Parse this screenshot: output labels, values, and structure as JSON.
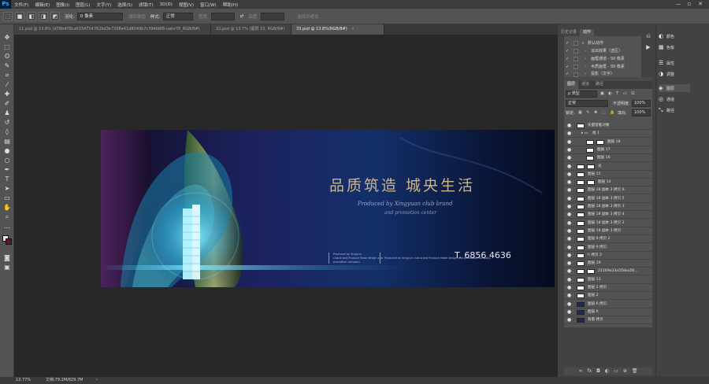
{
  "app": {
    "logo": "Ps"
  },
  "menu": [
    "文件(F)",
    "编辑(E)",
    "图像(I)",
    "图层(L)",
    "文字(Y)",
    "选择(S)",
    "滤镜(T)",
    "3D(D)",
    "视图(V)",
    "窗口(W)",
    "帮助(H)"
  ],
  "window_controls": {
    "minimize": "—",
    "restore": "▫",
    "close": "✕"
  },
  "options_bar": {
    "feather_label": "羽化:",
    "feather_value": "0 像素",
    "antialias_label": "消除锯齿",
    "style_label": "样式:",
    "style_value": "正常",
    "width_label": "宽度:",
    "height_label": "高度:",
    "select_mask_label": "选择并遮住..."
  },
  "document_tabs": [
    {
      "label": "11.psd @ 13.8% (d78b478ca6334754762bd3e7308e41d8040b7c394b6f8-uakv7E_RGB/8#)",
      "active": false
    },
    {
      "label": "22.psd @ 13.7% (图层 13, RGB/8#)",
      "active": false
    },
    {
      "label": "33.psd @ 13.8%(RGB/8#)",
      "active": true
    }
  ],
  "tab_close": "×",
  "banner": {
    "headline": "品质筑造  城央生活",
    "script_line1": "Produced by Xingyuan club brand",
    "script_line2": "and promotion center",
    "small_text_1": "Produced by Xingyun\nclub brand Produce Made design and\npromotion company",
    "small_text_2": "Produced by Xingyun club brand Produce Made design and promotion company",
    "phone": "T. 6856 4636"
  },
  "status_bar": {
    "zoom": "13.77%",
    "doc": "文档:79.2M/829.7M",
    "arrow": "›"
  },
  "history_tabs": [
    "历史记录",
    "动作"
  ],
  "actions": [
    {
      "label": "默认动作",
      "arrow": "∨",
      "checked": true
    },
    {
      "label": "淡出效果（选区）",
      "arrow": "›",
      "checked": true
    },
    {
      "label": "画框通道 - 50 像素",
      "arrow": "›",
      "checked": true
    },
    {
      "label": "木质画框 - 50 像素",
      "arrow": "›",
      "checked": true
    },
    {
      "label": "投影（文字）",
      "arrow": "›",
      "checked": true
    }
  ],
  "right_strip": [
    {
      "icon": "◐",
      "label": "颜色"
    },
    {
      "icon": "▦",
      "label": "色板"
    },
    {
      "icon": "☰",
      "label": "属性"
    },
    {
      "icon": "◑",
      "label": "调整"
    },
    {
      "icon": "◈",
      "label": "图层"
    },
    {
      "icon": "◎",
      "label": "通道"
    },
    {
      "icon": "⤡",
      "label": "路径"
    }
  ],
  "layers_tabs": [
    "图层",
    "通道",
    "路径"
  ],
  "layers_controls": {
    "kind_label": "ρ 类型",
    "blend_mode": "正常",
    "opacity_label": "不透明度:",
    "opacity_value": "100%",
    "lock_label": "锁定:",
    "fill_label": "填充:",
    "fill_value": "100%"
  },
  "layers": [
    {
      "name": "矢量智能对象",
      "indent": 0
    },
    {
      "name": "组 1",
      "indent": 1,
      "group": true
    },
    {
      "name": "图层 18",
      "indent": 2,
      "mask": true
    },
    {
      "name": "图层 17",
      "indent": 2
    },
    {
      "name": "图层 16",
      "indent": 2
    },
    {
      "name": "光",
      "indent": 0,
      "mask": true
    },
    {
      "name": "图层 15",
      "indent": 0
    },
    {
      "name": "图层 14",
      "indent": 0,
      "mask": true
    },
    {
      "name": "图层 18 副本 3 拷贝 6",
      "indent": 0
    },
    {
      "name": "图层 18 副本 3 拷贝 5",
      "indent": 0
    },
    {
      "name": "图层 18 副本 3 拷贝 3",
      "indent": 0
    },
    {
      "name": "图层 18 副本 3 拷贝 4",
      "indent": 0
    },
    {
      "name": "图层 18 副本 3 拷贝 2",
      "indent": 0
    },
    {
      "name": "图层 18 副本 3 拷贝",
      "indent": 0
    },
    {
      "name": "图层 9 拷贝 2",
      "indent": 0
    },
    {
      "name": "图层 9 拷贝",
      "indent": 0
    },
    {
      "name": "h 拷贝 2",
      "indent": 0
    },
    {
      "name": "图层 19",
      "indent": 0
    },
    {
      "name": "21169e33a558ea56...",
      "indent": 0,
      "mask": true
    },
    {
      "name": "图层 13",
      "indent": 0
    },
    {
      "name": "图层 2 拷贝",
      "indent": 0
    },
    {
      "name": "图层 2",
      "indent": 0
    },
    {
      "name": "图层 6 拷贝",
      "indent": 0,
      "dark": true
    },
    {
      "name": "图层 6",
      "indent": 0,
      "dark": true
    },
    {
      "name": "背景 拷贝",
      "indent": 0,
      "dark": true
    }
  ],
  "layers_footer": [
    "∞",
    "fx",
    "◘",
    "◐",
    "▭",
    "⊕",
    "🗑"
  ]
}
